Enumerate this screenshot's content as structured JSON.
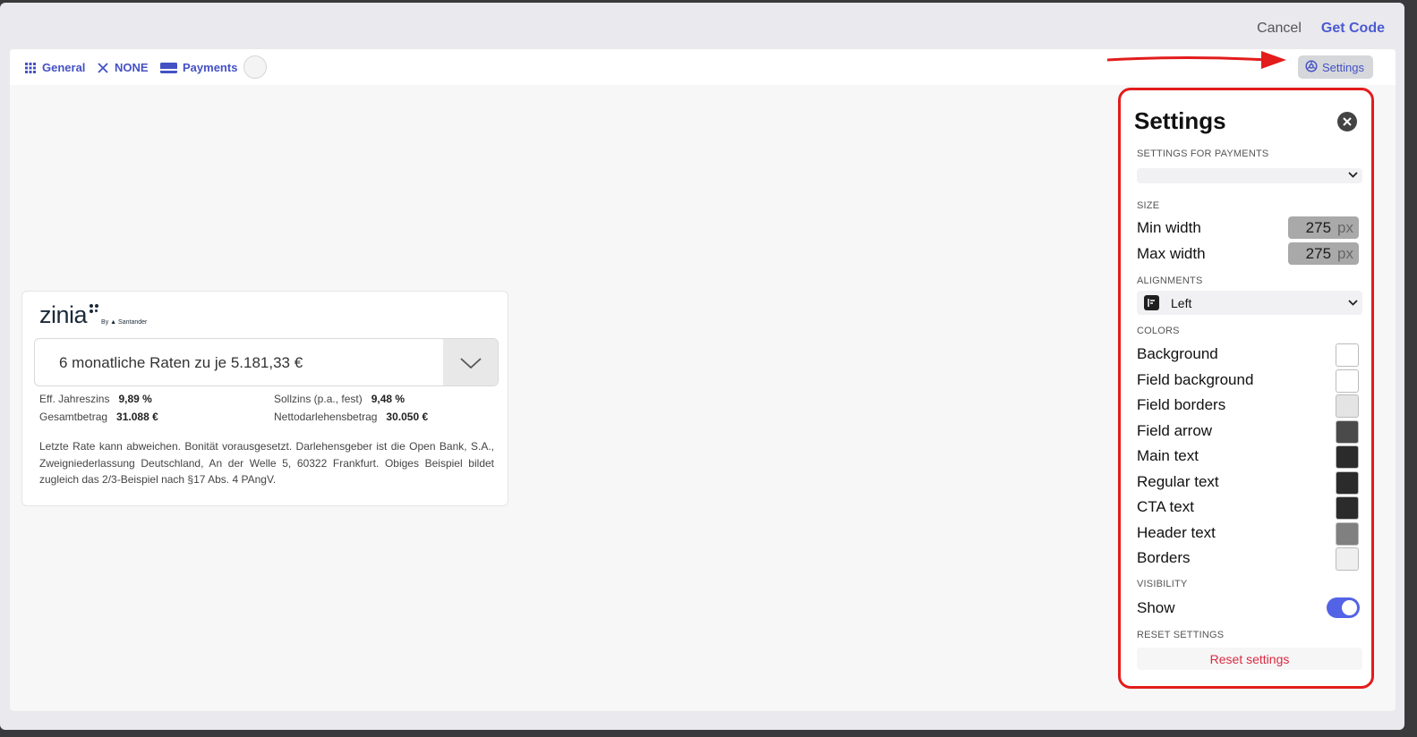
{
  "header": {
    "cancel_label": "Cancel",
    "get_code_label": "Get Code"
  },
  "toolbar": {
    "general_label": "General",
    "none_label": "NONE",
    "payments_label": "Payments",
    "settings_label": "Settings"
  },
  "widget": {
    "logo_text": "zinia",
    "logo_by": "By",
    "logo_brand": "Santander",
    "select_value": "6 monatliche Raten zu je 5.181,33 €",
    "facts": [
      {
        "label": "Eff. Jahreszins",
        "value": "9,89 %"
      },
      {
        "label": "Sollzins (p.a., fest)",
        "value": "9,48 %"
      },
      {
        "label": "Gesamtbetrag",
        "value": "31.088 €"
      },
      {
        "label": "Nettodarlehensbetrag",
        "value": "30.050 €"
      }
    ],
    "legal_text": "Letzte Rate kann abweichen. Bonität vorausgesetzt. Darlehensgeber ist die Open Bank, S.A., Zweigniederlassung Deutschland, An der Welle 5, 60322 Frankfurt. Obiges Beispiel bildet zugleich das 2/3-Beispiel nach §17 Abs. 4 PAngV."
  },
  "settings": {
    "title": "Settings",
    "settings_for_label": "SETTINGS FOR PAYMENTS",
    "settings_for_value": "",
    "size_label": "SIZE",
    "min_width": {
      "label": "Min width",
      "value": "275",
      "unit": "px"
    },
    "max_width": {
      "label": "Max width",
      "value": "275",
      "unit": "px"
    },
    "alignments_label": "ALIGNMENTS",
    "alignment_value": "Left",
    "colors_label": "COLORS",
    "colors": [
      {
        "label": "Background",
        "color": "#ffffff"
      },
      {
        "label": "Field background",
        "color": "#ffffff"
      },
      {
        "label": "Field borders",
        "color": "#e4e4e4"
      },
      {
        "label": "Field arrow",
        "color": "#4a4a4a"
      },
      {
        "label": "Main text",
        "color": "#2b2b2b"
      },
      {
        "label": "Regular text",
        "color": "#2b2b2b"
      },
      {
        "label": "CTA text",
        "color": "#2b2b2b"
      },
      {
        "label": "Header text",
        "color": "#808080"
      },
      {
        "label": "Borders",
        "color": "#efefef"
      }
    ],
    "visibility_label": "VISIBILITY",
    "show_label": "Show",
    "show_enabled": true,
    "reset_section_label": "RESET SETTINGS",
    "reset_button_label": "Reset settings"
  },
  "theme": {
    "accent": "#4451c4",
    "highlight": "#e31c1c",
    "danger_text": "#d92a3f"
  }
}
